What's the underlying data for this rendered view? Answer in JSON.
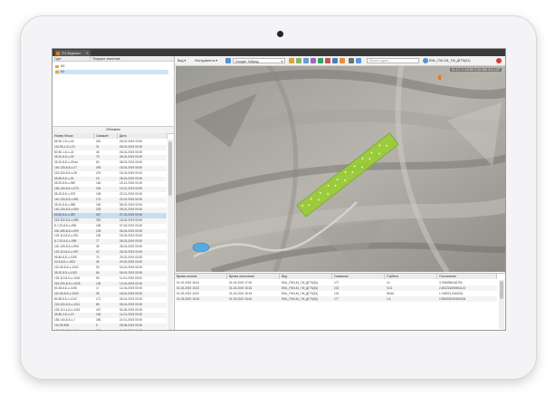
{
  "window": {
    "tab_title": "ГН Журнал",
    "tab_close": "✕"
  },
  "left_panel": {
    "headers": {
      "group": "Груп",
      "current_state": "Текущее значение"
    },
    "tree_items": [
      {
        "label": "A0",
        "selected": false
      },
      {
        "label": "A1",
        "selected": true
      }
    ],
    "update_button": "Обновить",
    "columns": [
      "Номер блока",
      "Скважин",
      "Дата"
    ],
    "rows": [
      [
        "55-90-1-Б-с-18",
        "261",
        "28-02-2019 00:00"
      ],
      [
        "110-95-1-Б-с-21",
        "31",
        "28-02-2019 00:00"
      ],
      [
        "80-80-1-Б-с-22",
        "46",
        "06-03-2019 00:00"
      ],
      [
        "35-20-8-Б-с-29",
        "75",
        "08-03-2019 00:00"
      ],
      [
        "35-20-8-Б-с-29-ип",
        "63",
        "08-03-2019 00:00"
      ],
      [
        "140-125-8-Б-с-27",
        "493",
        "15-03-2019 00:00"
      ],
      [
        "215-200-8-Б-с-28",
        "276",
        "16-03-2019 00:00"
      ],
      [
        "55-80-8-Б-с-30",
        "18",
        "28-03-2019 00:00"
      ],
      [
        "35-20-8-Б-с-960",
        "164",
        "15-12-2018 00:00"
      ],
      [
        "155-140-8-Б-с-975",
        "154",
        "15-01-2019 00:00"
      ],
      [
        "35-20-8-Б-с-979",
        "108",
        "22-01-2019 00:00"
      ],
      [
        "140-125-8-Б-с-981",
        "172",
        "22-02-2019 00:00"
      ],
      [
        "35-20-8-Б-с-983",
        "150",
        "08-02-2019 00:00"
      ],
      [
        "140-125-8-Б-с-984",
        "203",
        "28-02-2019 00:00"
      ],
      [
        "65-80-8-Б-с-987",
        "347",
        "27-03-2019 00:00"
      ],
      [
        "215-200-8-Б-с-989",
        "252",
        "15-03-2019 00:00"
      ],
      [
        "8-7-20-8-Б-с-990",
        "156",
        "07-03-2019 00:00"
      ],
      [
        "200-185-8-Б-с-990",
        "109",
        "28-03-2019 00:00"
      ],
      [
        "125-110-8-Б-с-991",
        "130",
        "15-03-2019 00:00"
      ],
      [
        "8-7-20-8-Б-с-995",
        "77",
        "28-03-2019 00:00"
      ],
      [
        "140-125-8-Б-с-996",
        "36",
        "28-03-2019 00:00"
      ],
      [
        "125-110-8-Б-с-997",
        "42",
        "28-03-2019 00:00"
      ],
      [
        "95-80-8-Б-с-1000",
        "73",
        "29-03-2019 00:00"
      ],
      [
        "20-5-8-Б-с-1001",
        "35",
        "29-03-2019 00:00"
      ],
      [
        "110-95-8-Б-с-1002",
        "30",
        "03-04-2019 00:00"
      ],
      [
        "35-20-8-Б-с-1003",
        "66",
        "05-04-2019 00:00"
      ],
      [
        "125-110-8-Б-с-1004",
        "95",
        "11-04-2019 00:00"
      ],
      [
        "215-200-8-Б-с-1005",
        "126",
        "12-04-2019 00:00"
      ],
      [
        "50-35-8-Б-с-1006",
        "17",
        "12-04-2019 00:00"
      ],
      [
        "110-95-8-Б-с-1009",
        "36",
        "18-04-2019 00:00"
      ],
      [
        "80-65-8-Б-с-1012",
        "171",
        "26-04-2019 00:00"
      ],
      [
        "215-200-8-Б-с-1011",
        "89",
        "26-04-2019 00:00"
      ],
      [
        "125-110-1-Б-с-1015",
        "167",
        "06-05-2019 00:00"
      ],
      [
        "35-80-2-Б-с-19",
        "146",
        "14-01-2019 00:00"
      ],
      [
        "155-140-8-Б-с-7",
        "156",
        "24-01-2019 00:00"
      ],
      [
        "110-95-К05",
        "9",
        "28-06-2019 00:00"
      ],
      [
        "165-150-8-Б-с-К4-1",
        "138",
        "26-07-2019 00:00"
      ]
    ],
    "selected_row": 14
  },
  "toolbar": {
    "view_label": "Вид ▾",
    "tools_label": "Инструменты ▾",
    "map_source": "Google: Гибрид",
    "search_placeholder": "Искать адрес...",
    "coord_system": "EML_ГМЧ-61_ГМ_ДГГК(61)",
    "coordinates": "X=1:2 Y=19.50  Z:22.054  3.0.1.27"
  },
  "bottom_table": {
    "columns": [
      "Время начала",
      "Время окончания",
      "Вид",
      "Скважина",
      "Глубина",
      "Отклонение"
    ],
    "rows": [
      [
        "01-03-2019 16:41",
        "01-03-2019 17:00",
        "EML_ГМЧ-61_ГМ_ДГГК(61)",
        "177",
        "14",
        "3.7966356162752"
      ],
      [
        "01-03-2019 15:22",
        "01-03-2019 15:33",
        "EML_ГМЧ-61_ГМ_ДГГК(61)",
        "223",
        "3.01",
        "2.463214690504141"
      ],
      [
        "01-03-2019 15:57",
        "01-03-2019 16:19",
        "EML_ГМЧ-61_ГМ_ДГГК(61)",
        "124",
        "95.66",
        "1.748021.9443431"
      ],
      [
        "01-03-2019 16:34",
        "01-03-2019 16:34",
        "EML_ГМЧ-61_ГМ_ДГГК(61)",
        "177",
        "1.6",
        "0.996302051500026"
      ]
    ]
  },
  "colors": {
    "accent": "#e07a1e",
    "titlebar": "#3a3a3a",
    "selection": "#c9dcf2",
    "blast_fill": "#9acd32"
  }
}
